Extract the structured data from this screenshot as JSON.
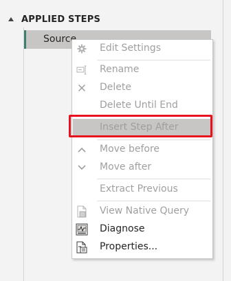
{
  "panel": {
    "title": "APPLIED STEPS"
  },
  "step": {
    "label": "Source"
  },
  "menu": {
    "edit_settings": "Edit Settings",
    "rename": "Rename",
    "delete": "Delete",
    "delete_until_end": "Delete Until End",
    "insert_step_after": "Insert Step After",
    "move_before": "Move before",
    "move_after": "Move after",
    "extract_previous": "Extract Previous",
    "view_native_query": "View Native Query",
    "diagnose": "Diagnose",
    "properties": "Properties..."
  },
  "colors": {
    "highlight": "#c8c6c4",
    "focus_border": "#e8111e",
    "step_accent": "#3e7f6c",
    "disabled_text": "#a19f9d"
  },
  "icons": {
    "collapse": "caret-up-icon",
    "edit_settings": "gear-icon",
    "rename": "rename-icon",
    "delete": "close-icon",
    "move_before": "chevron-up-icon",
    "move_after": "chevron-down-icon",
    "view_native_query": "document-icon",
    "diagnose": "diagnose-icon",
    "properties": "properties-icon"
  }
}
